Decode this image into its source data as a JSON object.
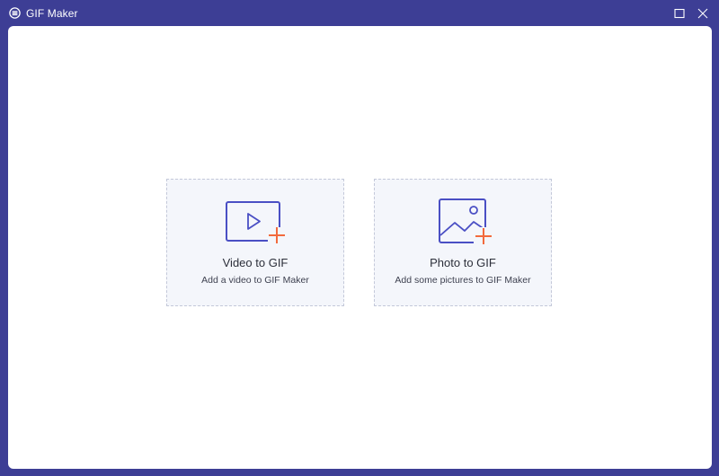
{
  "window": {
    "title": "GIF Maker",
    "app_icon": "gif-logo-icon",
    "controls": [
      "maximize-icon",
      "close-icon"
    ]
  },
  "options": [
    {
      "title": "Video to GIF",
      "subtitle": "Add a video to GIF Maker",
      "icon": "video-add-icon"
    },
    {
      "title": "Photo to GIF",
      "subtitle": "Add some pictures to GIF Maker",
      "icon": "photo-add-icon"
    }
  ],
  "colors": {
    "frame": "#3d3e95",
    "icon_stroke": "#4a4fc4",
    "plus_accent": "#f26a3d",
    "card_bg": "#f4f6fb",
    "card_border": "#c3c8d9"
  }
}
